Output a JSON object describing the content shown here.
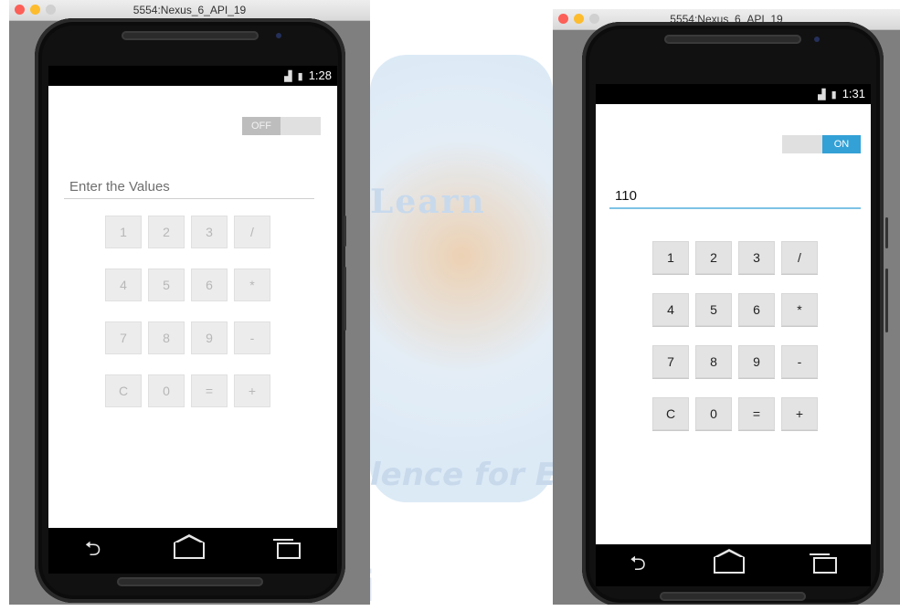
{
  "watermark": {
    "word_top": "Learn",
    "word_mid": "lence for Em",
    "word_bottom": "wathi"
  },
  "left_emulator": {
    "title": "5554:Nexus_6_API_19",
    "status_time": "1:28",
    "toggle_label": "OFF",
    "input_placeholder": "Enter the Values",
    "keys": [
      "1",
      "2",
      "3",
      "/",
      "4",
      "5",
      "6",
      "*",
      "7",
      "8",
      "9",
      "-",
      "C",
      "0",
      "=",
      "+"
    ]
  },
  "right_emulator": {
    "title": "5554:Nexus_6_API_19",
    "status_time": "1:31",
    "toggle_label": "ON",
    "input_value": "110",
    "keys": [
      "1",
      "2",
      "3",
      "/",
      "4",
      "5",
      "6",
      "*",
      "7",
      "8",
      "9",
      "-",
      "C",
      "0",
      "=",
      "+"
    ]
  },
  "icons": {
    "back": "back-icon",
    "home": "home-icon",
    "recents": "recents-icon",
    "signal": "signal-icon",
    "battery": "battery-icon"
  },
  "colors": {
    "toggle_on": "#33a1d6",
    "input_focus_underline": "#7ec3e5",
    "close": "#fc5f57",
    "minimize": "#fdbc2e"
  }
}
